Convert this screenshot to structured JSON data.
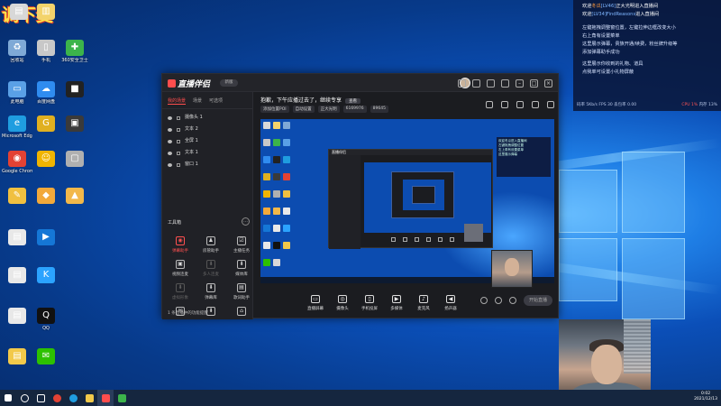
{
  "watermark": {
    "logo_text": "调下麦"
  },
  "desktop": {
    "icons": [
      {
        "label": "",
        "color": "#d8d8d8",
        "glyph": "▤"
      },
      {
        "label": "",
        "color": "#f3d36b",
        "glyph": "▥"
      },
      {
        "label": "回收站",
        "color": "#7fa9d6",
        "glyph": "♻"
      },
      {
        "label": "手机",
        "color": "#c8c8c8",
        "glyph": "▯"
      },
      {
        "label": "360安全卫士",
        "color": "#3cb44b",
        "glyph": "✚"
      },
      {
        "label": "此电脑",
        "color": "#5aa0e6",
        "glyph": "▭"
      },
      {
        "label": "百度网盘",
        "color": "#2f8cf0",
        "glyph": "☁"
      },
      {
        "label": "",
        "color": "#222222",
        "glyph": "■"
      },
      {
        "label": "Microsoft Edge",
        "color": "#1f9de0",
        "glyph": "e"
      },
      {
        "label": "",
        "color": "#e0b020",
        "glyph": "G"
      },
      {
        "label": "",
        "color": "#3a3a3a",
        "glyph": "▣"
      },
      {
        "label": "Google Chrome",
        "color": "#e34234",
        "glyph": "◉"
      },
      {
        "label": "",
        "color": "#f0b400",
        "glyph": "☺"
      },
      {
        "label": "",
        "color": "#b0b0b0",
        "glyph": "▢"
      },
      {
        "label": "",
        "color": "#f0c040",
        "glyph": "✎"
      },
      {
        "label": "",
        "color": "#f2a93b",
        "glyph": "◆"
      },
      {
        "label": "",
        "color": "#f2b84a",
        "glyph": "▲"
      },
      {
        "label": "",
        "color": "#e8e8e8",
        "glyph": "▤"
      },
      {
        "label": "",
        "color": "#1577d6",
        "glyph": "▶"
      },
      {
        "label": "",
        "color": "#e8e8e8",
        "glyph": "▤"
      },
      {
        "label": "",
        "color": "#2ba3ff",
        "glyph": "K"
      },
      {
        "label": "",
        "color": "#e8e8e8",
        "glyph": "▤"
      },
      {
        "label": "QQ",
        "color": "#111111",
        "glyph": "Q"
      },
      {
        "label": "",
        "color": "#f2c94a",
        "glyph": "▤"
      },
      {
        "label": "",
        "color": "#2dc100",
        "glyph": "✉"
      }
    ]
  },
  "chat": {
    "messages": [
      {
        "prefix": "欢迎",
        "name": "冬瓜",
        "level": "[LV46]",
        "suffix": "正大光明进入直播间"
      },
      {
        "prefix": "欢迎",
        "name": "",
        "level": "[LV34]FindReasons",
        "suffix": "进入直播间"
      }
    ],
    "system": [
      "左键拖拽调整窗位置，左键拉伸边框改变大小",
      "右上角有设置菜单",
      "这里展示弹幕，贵族开通/续费，粉丝牌升级等",
      "添加弹幕助手成功",
      "这里展示你收到的礼物、道具",
      "点我单可设置小礼物屏蔽"
    ],
    "stats": {
      "left": "码率 5Kb/s FPS 30 丢包率 0.00",
      "cpu": "CPU 1%",
      "mem": "内存 13%"
    }
  },
  "app": {
    "brand": "直播伴侣",
    "version": "新版",
    "sidebar": {
      "tabs": [
        "我的场景",
        "场景",
        "可选项"
      ],
      "scenes": [
        "摄像头 1",
        "文本 2",
        "全屏 1",
        "文本 1",
        "窗口 1"
      ],
      "tools_title": "工具箱",
      "tools": [
        {
          "label": "弹幕助手",
          "glyph": "◉",
          "style": "red"
        },
        {
          "label": "房管助手",
          "glyph": "♟",
          "style": ""
        },
        {
          "label": "主播任务",
          "glyph": "☑",
          "style": ""
        },
        {
          "label": "视频连麦",
          "glyph": "▣",
          "style": ""
        },
        {
          "label": "多人连麦",
          "glyph": "⬇",
          "style": "dim"
        },
        {
          "label": "媒体库",
          "glyph": "⬇",
          "style": ""
        },
        {
          "label": "虚拟形象",
          "glyph": "⬇",
          "style": "dim"
        },
        {
          "label": "弹幕库",
          "glyph": "⬇",
          "style": ""
        },
        {
          "label": "歌词助手",
          "glyph": "▤",
          "style": ""
        },
        {
          "label": "",
          "glyph": "✉",
          "style": ""
        },
        {
          "label": "",
          "glyph": "⬇",
          "style": ""
        },
        {
          "label": "",
          "glyph": "⌂",
          "style": ""
        }
      ],
      "footer": "1 条直播中的功能提醒"
    },
    "content": {
      "notice": "抱歉，下午应播过去了，继续专享",
      "notice_button": "查看",
      "chips": [
        "添加位置POI",
        "自动设置",
        "正大光明",
        "6169976",
        "89645"
      ],
      "preview_mini_title": "直播伴侣",
      "nested_chat_lines": [
        "欢迎冬瓜进入直播间",
        "左键拖拽调整位置",
        "右上角有设置菜单",
        "这里展示弹幕"
      ],
      "bottom_buttons": [
        {
          "label": "直播屏幕",
          "glyph": "▭"
        },
        {
          "label": "摄像头",
          "glyph": "◎"
        },
        {
          "label": "手机投屏",
          "glyph": "▯"
        },
        {
          "label": "多媒体",
          "glyph": "▶"
        },
        {
          "label": "麦克风",
          "glyph": "♪"
        },
        {
          "label": "扬声器",
          "glyph": "◀"
        }
      ],
      "start_live": "开始直播"
    }
  },
  "taskbar": {
    "time": "0:02",
    "date": "2021/12/13"
  }
}
